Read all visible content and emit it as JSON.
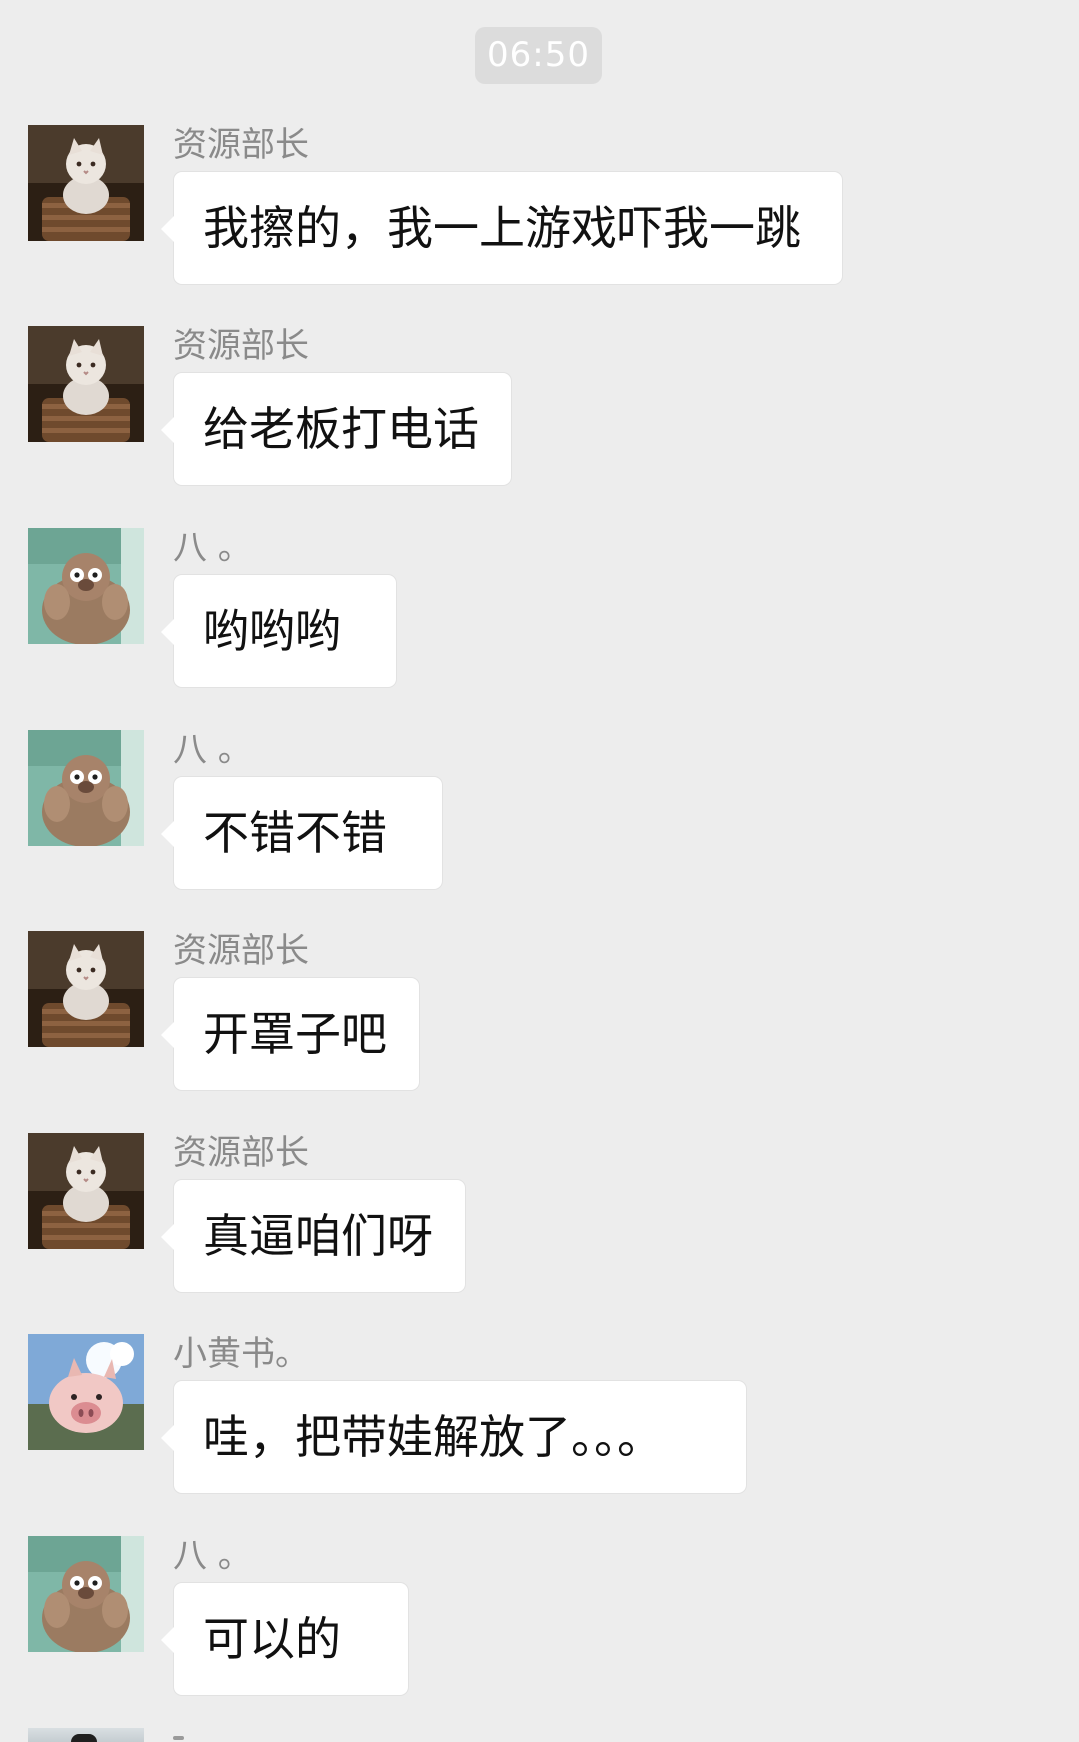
{
  "time_label": "06:50",
  "messages": [
    {
      "sender": "资源部长",
      "text": "我擦的，我一上游戏吓我一跳",
      "avatar": "cat-icon"
    },
    {
      "sender": "资源部长",
      "text": "给老板打电话",
      "avatar": "cat-icon"
    },
    {
      "sender": "八 。",
      "text": "哟哟哟",
      "avatar": "bear-icon"
    },
    {
      "sender": "八 。",
      "text": "不错不错",
      "avatar": "bear-icon"
    },
    {
      "sender": "资源部长",
      "text": "开罩子吧",
      "avatar": "cat-icon"
    },
    {
      "sender": "资源部长",
      "text": "真逼咱们呀",
      "avatar": "cat-icon"
    },
    {
      "sender": "小黄书。",
      "text": "哇，把带娃解放了。。。",
      "avatar": "pig-icon"
    },
    {
      "sender": "八 。",
      "text": "可以的",
      "avatar": "bear-icon"
    }
  ],
  "colors": {
    "background": "#ededed",
    "bubble": "#ffffff",
    "sender_text": "#8a8a8a",
    "message_text": "#111111",
    "time_pill": "#dcdcdc"
  }
}
